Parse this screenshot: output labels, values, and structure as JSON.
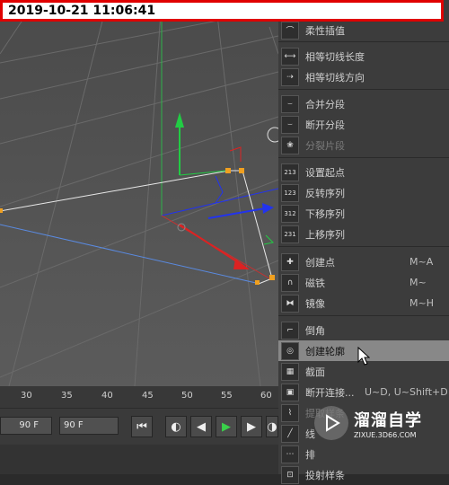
{
  "timestamp": "2019-10-21 11:06:41",
  "menu": {
    "items": [
      {
        "label": "柔性插值",
        "icon": "curve-soft-icon",
        "glyph": "⌒",
        "shortcut": "",
        "disabled": false
      },
      {
        "label": "相等切线长度",
        "icon": "equal-tangent-length-icon",
        "glyph": "⟷",
        "shortcut": "",
        "disabled": false
      },
      {
        "label": "相等切线方向",
        "icon": "equal-tangent-direction-icon",
        "glyph": "⇢",
        "shortcut": "",
        "disabled": false
      },
      {
        "label": "合并分段",
        "icon": "join-segment-icon",
        "glyph": "⌣",
        "shortcut": "",
        "disabled": false
      },
      {
        "label": "断开分段",
        "icon": "break-segment-icon",
        "glyph": "⌣",
        "shortcut": "",
        "disabled": false
      },
      {
        "label": "分裂片段",
        "icon": "explode-segments-icon",
        "glyph": "❀",
        "shortcut": "",
        "disabled": true
      },
      {
        "label": "设置起点",
        "icon": "set-first-point-icon",
        "glyph": "213",
        "shortcut": "",
        "disabled": false
      },
      {
        "label": "反转序列",
        "icon": "reverse-sequence-icon",
        "glyph": "123",
        "shortcut": "",
        "disabled": false
      },
      {
        "label": "下移序列",
        "icon": "move-down-sequence-icon",
        "glyph": "312",
        "shortcut": "",
        "disabled": false
      },
      {
        "label": "上移序列",
        "icon": "move-up-sequence-icon",
        "glyph": "231",
        "shortcut": "",
        "disabled": false
      },
      {
        "label": "创建点",
        "icon": "create-point-icon",
        "glyph": "✚",
        "shortcut": "M~A",
        "disabled": false
      },
      {
        "label": "磁铁",
        "icon": "magnet-icon",
        "glyph": "∩",
        "shortcut": "M~",
        "disabled": false
      },
      {
        "label": "镜像",
        "icon": "mirror-icon",
        "glyph": "⧓",
        "shortcut": "M~H",
        "disabled": false
      },
      {
        "label": "倒角",
        "icon": "chamfer-icon",
        "glyph": "⌐",
        "shortcut": "",
        "disabled": false
      },
      {
        "label": "创建轮廓",
        "icon": "create-outline-icon",
        "glyph": "◎",
        "shortcut": "",
        "disabled": false
      },
      {
        "label": "截面",
        "icon": "cross-section-icon",
        "glyph": "▦",
        "shortcut": "",
        "disabled": false
      },
      {
        "label": "断开连接...",
        "icon": "disconnect-icon",
        "glyph": "▣",
        "shortcut": "U~D, U~Shift+D",
        "disabled": false
      },
      {
        "label": "提取样条",
        "icon": "extract-spline-icon",
        "glyph": "⌇",
        "shortcut": "",
        "disabled": true
      },
      {
        "label": "线",
        "icon": "line-icon",
        "glyph": "╱",
        "shortcut": "",
        "disabled": false
      },
      {
        "label": "排",
        "icon": "arrange-icon",
        "glyph": "⋯",
        "shortcut": "",
        "disabled": false
      },
      {
        "label": "投射样条",
        "icon": "project-spline-icon",
        "glyph": "⊡",
        "shortcut": "",
        "disabled": false
      }
    ]
  },
  "timeline": {
    "ticks": [
      "30",
      "35",
      "40",
      "45",
      "50",
      "55",
      "60"
    ],
    "start_field": "90 F",
    "end_field": "90 F"
  },
  "transport": {
    "goto_start_icon": "goto-start-icon",
    "record_icon": "record-icon",
    "prev_frame_icon": "previous-frame-icon",
    "play_icon": "play-icon",
    "next_frame_icon": "next-frame-icon"
  },
  "watermark": {
    "title": "溜溜自学",
    "url": "ZIXUE.3D66.COM"
  },
  "colors": {
    "highlight": "#888888",
    "timestamp_border": "#e00000",
    "y_axis": "#22cc44",
    "x_axis": "#dd2222",
    "z_axis": "#2233ee"
  }
}
